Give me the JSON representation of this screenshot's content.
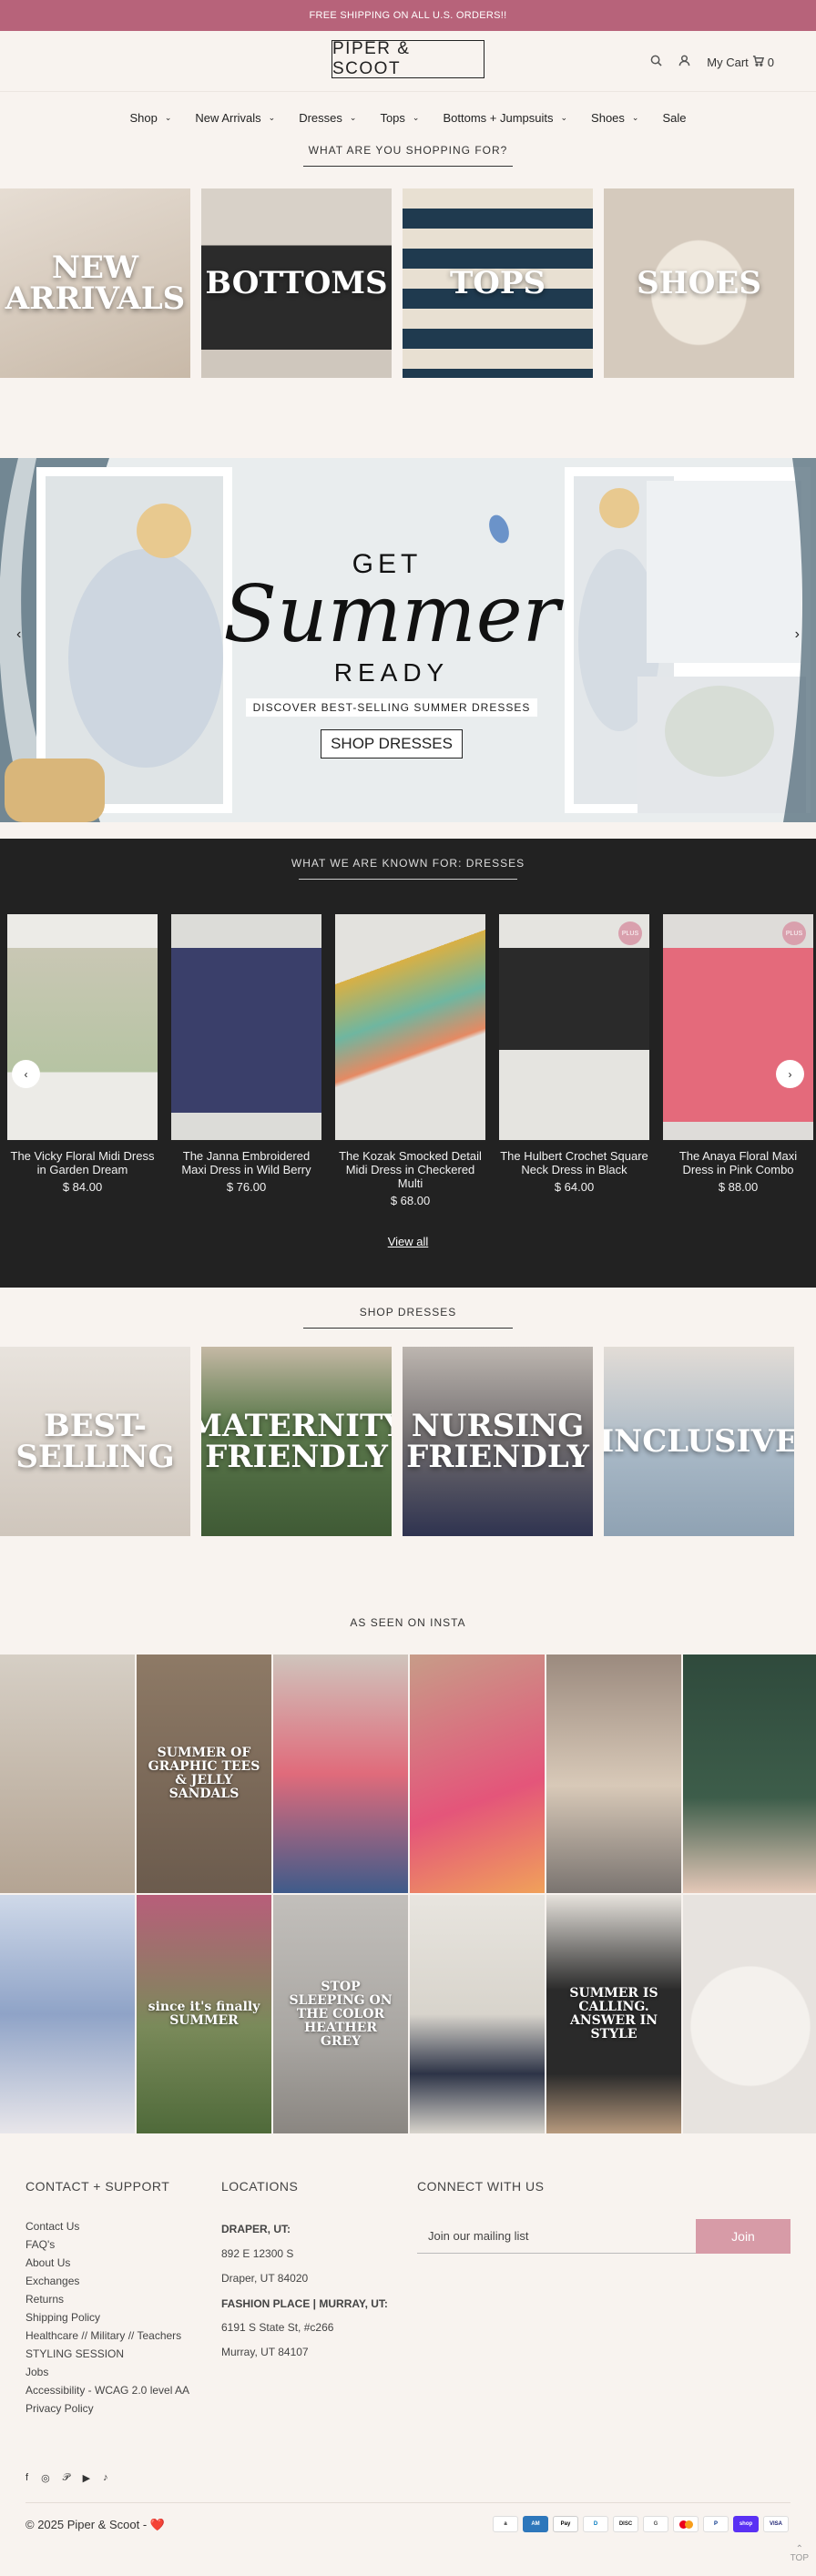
{
  "promo": "FREE SHIPPING ON ALL U.S. ORDERS!!",
  "logo": "PIPER & SCOOT",
  "header": {
    "cart_label": "My Cart",
    "cart_count": "0"
  },
  "nav": [
    {
      "label": "Shop",
      "dropdown": true
    },
    {
      "label": "New Arrivals",
      "dropdown": true
    },
    {
      "label": "Dresses",
      "dropdown": true
    },
    {
      "label": "Tops",
      "dropdown": true
    },
    {
      "label": "Bottoms + Jumpsuits",
      "dropdown": true
    },
    {
      "label": "Shoes",
      "dropdown": true
    },
    {
      "label": "Sale",
      "dropdown": false
    }
  ],
  "shopping": {
    "title": "WHAT ARE YOU SHOPPING FOR?",
    "tiles": [
      {
        "label": "NEW ARRIVALS",
        "color": "#d7ccbf"
      },
      {
        "label": "BOTTOMS",
        "color": "#cfc7bd"
      },
      {
        "label": "TOPS",
        "color": "#c4b09a"
      },
      {
        "label": "SHOES",
        "color": "#d9cfc4"
      }
    ]
  },
  "hero": {
    "get": "GET",
    "summer": "Summer",
    "ready": "READY",
    "sub": "DISCOVER BEST-SELLING SUMMER DRESSES",
    "button": "SHOP DRESSES"
  },
  "known_for": {
    "title": "WHAT WE ARE KNOWN FOR: DRESSES",
    "products": [
      {
        "name": "The Vicky Floral Midi Dress in Garden Dream",
        "price": "$ 84.00",
        "badge": "",
        "color": "#b6c4a3"
      },
      {
        "name": "The Janna Embroidered Maxi Dress in Wild Berry",
        "price": "$ 76.00",
        "badge": "",
        "color": "#3a3f6a"
      },
      {
        "name": "The Kozak Smocked Detail Midi Dress in Checkered Multi",
        "price": "$ 68.00",
        "badge": "",
        "color": "#d9b044"
      },
      {
        "name": "The Hulbert Crochet Square Neck Dress in Black",
        "price": "$ 64.00",
        "badge": "PLUS",
        "color": "#2a2a2a"
      },
      {
        "name": "The Anaya Floral Maxi Dress in Pink Combo",
        "price": "$ 88.00",
        "badge": "PLUS",
        "color": "#e46a7b"
      }
    ],
    "view_all": "View all"
  },
  "shop_dresses": {
    "title": "SHOP DRESSES",
    "tiles": [
      {
        "label": "BEST-SELLING",
        "color": "#d9d2cb"
      },
      {
        "label": "MATERNITY FRIENDLY",
        "color": "#5d7a4d"
      },
      {
        "label": "NURSING FRIENDLY",
        "color": "#6e6a6c"
      },
      {
        "label": "INCLUSIVE",
        "color": "#a8b8c6"
      }
    ]
  },
  "insta": {
    "title": "AS SEEN ON INSTA",
    "cells": [
      {
        "caption": "",
        "color": "#c9bfb3"
      },
      {
        "caption": "SUMMER OF GRAPHIC TEES & JELLY SANDALS",
        "color": "#7d6d5f"
      },
      {
        "caption": "",
        "color": "#b9a8a0"
      },
      {
        "caption": "",
        "color": "#e4557a"
      },
      {
        "caption": "",
        "color": "#8e8078"
      },
      {
        "caption": "",
        "color": "#2f4a3c"
      },
      {
        "caption": "",
        "color": "#8fa3c7"
      },
      {
        "caption": "since it's finally SUMMER",
        "color": "#7a8a5a"
      },
      {
        "caption": "STOP SLEEPING ON THE COLOR HEATHER GREY",
        "color": "#a9a6a2"
      },
      {
        "caption": "",
        "color": "#d8d4cc"
      },
      {
        "caption": "SUMMER IS CALLING. ANSWER IN STYLE",
        "color": "#b79a7e"
      },
      {
        "caption": "",
        "color": "#e7e3df"
      }
    ]
  },
  "footer": {
    "contact_title": "CONTACT + SUPPORT",
    "links": [
      "Contact Us",
      "FAQ's",
      "About Us",
      "Exchanges",
      "Returns",
      "Shipping Policy",
      "Healthcare // Military // Teachers",
      "STYLING SESSION",
      "Jobs",
      "Accessibility - WCAG 2.0 level AA",
      "Privacy Policy"
    ],
    "locations_title": "LOCATIONS",
    "loc1_name": "DRAPER, UT:",
    "loc1_addr1": "892 E 12300 S",
    "loc1_addr2": "Draper, UT 84020",
    "loc2_name": "FASHION PLACE | MURRAY, UT:",
    "loc2_addr1": "6191 S State St, #c266",
    "loc2_addr2": "Murray, UT 84107",
    "connect_title": "CONNECT WITH US",
    "mailing_placeholder": "Join our mailing list",
    "join_label": "Join",
    "copyright": "© 2025 Piper & Scoot - ❤️",
    "payments": [
      "amazon",
      "amex",
      "apple-pay",
      "diners",
      "discover",
      "google-pay",
      "mastercard",
      "paypal",
      "shop-pay",
      "visa"
    ],
    "top_label": "TOP"
  }
}
